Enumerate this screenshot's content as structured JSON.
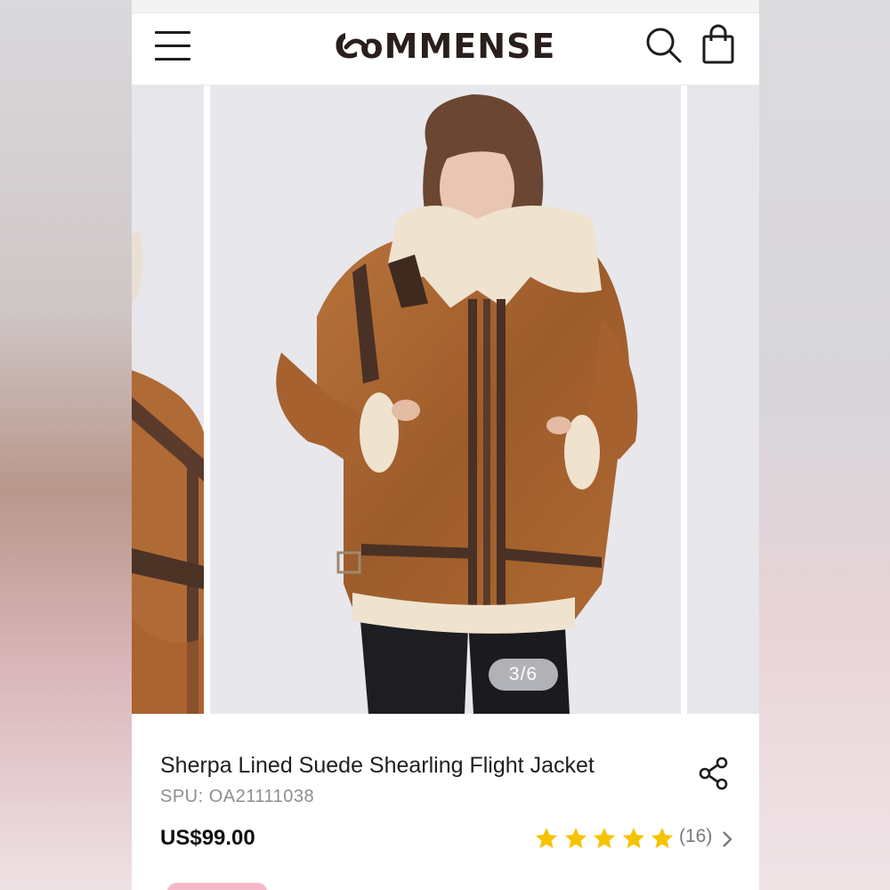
{
  "header": {
    "brand": "CoMMENSE",
    "menu_icon": "hamburger-menu-icon",
    "search_icon": "search-icon",
    "bag_icon": "shopping-bag-icon"
  },
  "gallery": {
    "current_slide": 3,
    "total_slides": 6,
    "counter_text": "3/6",
    "images": [
      "product-photo-detail-previous",
      "product-photo-model-front",
      "product-photo-next"
    ]
  },
  "product": {
    "title": "Sherpa Lined Suede Shearling Flight Jacket",
    "spu": "SPU: OA21111038",
    "price": "US$99.00",
    "rating_stars": 5,
    "rating_count": "(16)",
    "share_icon": "share-icon"
  },
  "colors": {
    "star": "#f5c400",
    "text_primary": "#1f1f1f",
    "text_muted": "#8e8e8e",
    "badge": "#f6b8c8",
    "logo": "#2a1f1d"
  }
}
